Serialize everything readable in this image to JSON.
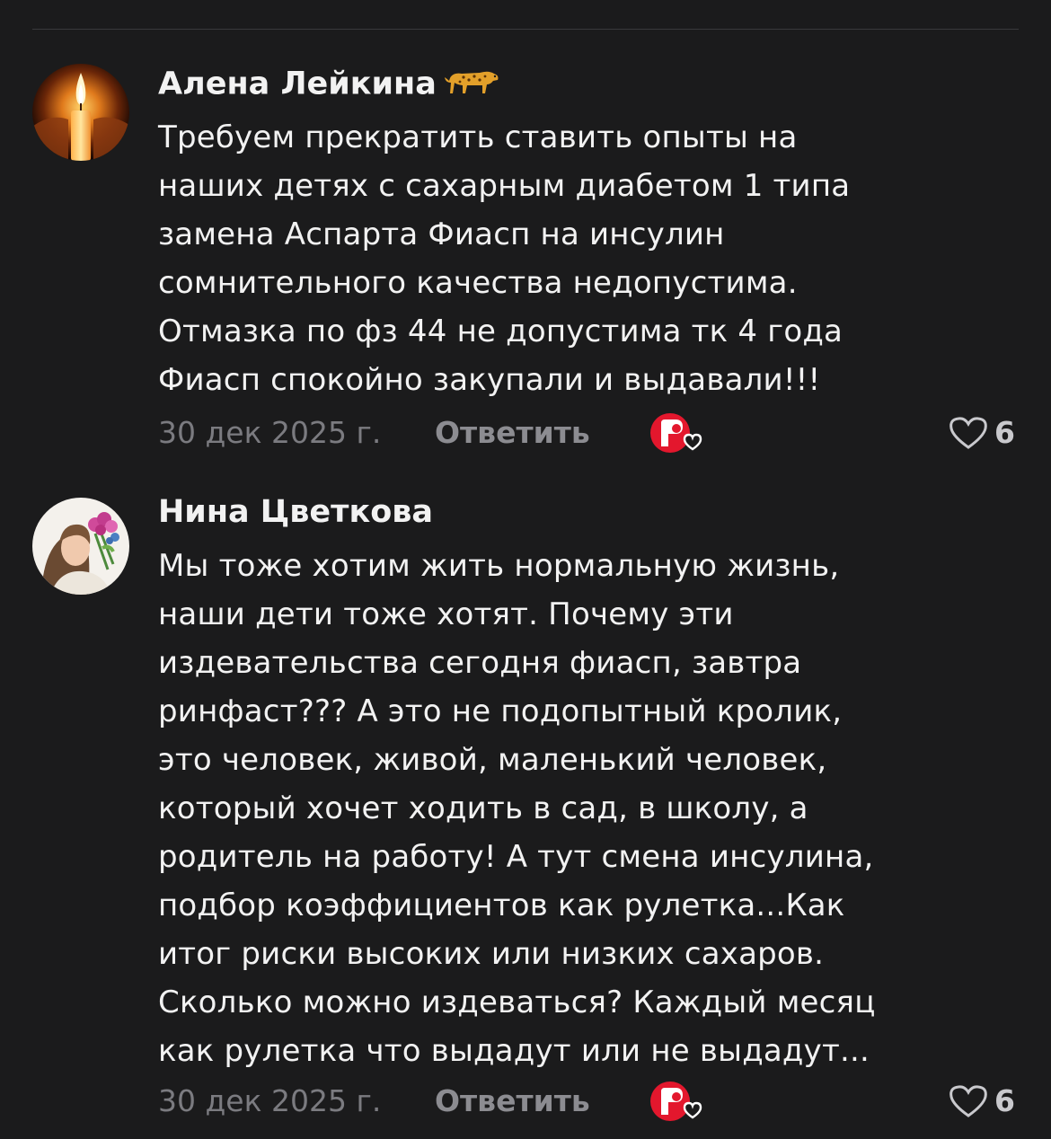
{
  "comments": [
    {
      "author": "Алена Лейкина",
      "author_emoji": "leopard-icon",
      "avatar": "candle-avatar",
      "lines": [
        "Требуем прекратить ставить опыты на",
        "наших детях с сахарным диабетом 1 типа",
        "замена Аспарта Фиасп на инсулин",
        "сомнительного качества недопустима.",
        "Отмазка по фз 44 не допустима тк 4 года",
        "Фиасп спокойно закупали и выдавали!!!"
      ],
      "date": "30 дек 2025 г.",
      "reply_label": "Ответить",
      "likes": "6"
    },
    {
      "author": "Нина Цветкова",
      "avatar": "woman-with-flowers-avatar",
      "lines": [
        "Мы тоже хотим жить нормальную жизнь,",
        "наши дети тоже хотят. Почему эти",
        "издевательства сегодня фиасп, завтра",
        "ринфаст??? А это не подопытный кролик,",
        "это человек, живой, маленький человек,",
        "который хочет ходить в сад, в школу, а",
        "родитель на работу! А тут смена инсулина,",
        "подбор коэффициентов как рулетка...Как",
        "итог риски высоких или низких сахаров.",
        "Сколько можно издеваться? Каждый месяц",
        "как рулетка что выдадут или не выдадут..."
      ],
      "date": "30 дек 2025 г.",
      "reply_label": "Ответить",
      "likes": "6"
    }
  ],
  "colors": {
    "background": "#1b1b1c",
    "text": "#f2f2f2",
    "muted": "#7b7b80",
    "badge_red": "#e3172d"
  }
}
